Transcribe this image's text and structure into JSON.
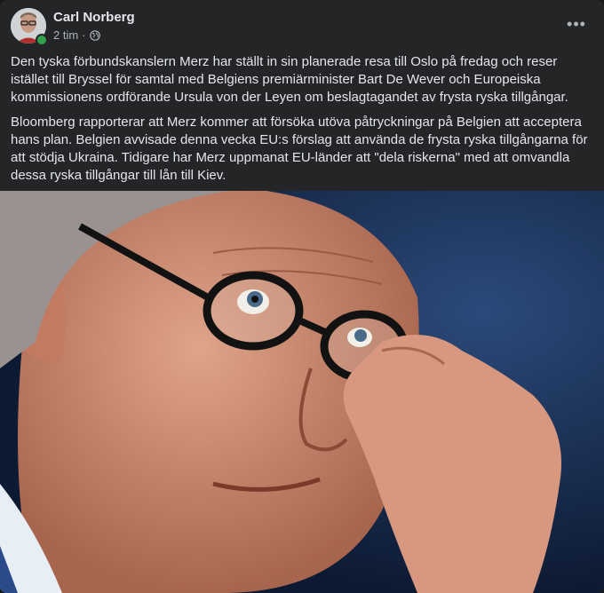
{
  "post": {
    "author": "Carl Norberg",
    "time": "2 tim",
    "separator": "·",
    "privacy_icon": "globe-icon",
    "more_icon": "more-options-icon",
    "more_label": "•••",
    "paragraphs": [
      "Den tyska förbundskanslern Merz har ställt in sin planerade resa till Oslo på fredag och reser istället till Bryssel för samtal med Belgiens premiärminister Bart De Wever och Europeiska kommissionens ordförande Ursula von der Leyen om beslagtagandet av frysta ryska tillgångar.",
      "Bloomberg rapporterar att Merz kommer att försöka utöva påtryckningar på Belgien att acceptera hans plan. Belgien avvisade denna vecka EU:s förslag att använda de frysta ryska tillgångarna för att stödja Ukraina. Tidigare har Merz uppmanat EU-länder att \"dela riskerna\" med att omvandla dessa ryska tillgångar till lån till Kiev."
    ]
  },
  "colors": {
    "card_bg": "#242526",
    "text_primary": "#e4e6eb",
    "text_secondary": "#b0b3b8",
    "online": "#31a24c",
    "photo_bg": "#1a2a4a"
  }
}
